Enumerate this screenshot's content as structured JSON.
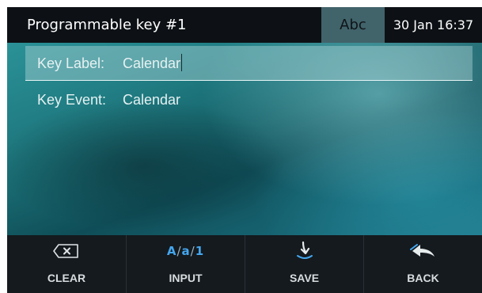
{
  "header": {
    "title": "Programmable key #1",
    "input_mode": "Abc",
    "datetime": "30 Jan 16:37"
  },
  "fields": [
    {
      "label": "Key Label:",
      "value": "Calendar",
      "selected": true
    },
    {
      "label": "Key Event:",
      "value": "Calendar",
      "selected": false
    }
  ],
  "softkeys": [
    {
      "label": "CLEAR",
      "icon": "backspace-icon"
    },
    {
      "label": "INPUT",
      "icon": "input-mode-icon",
      "glyph_parts": [
        "A",
        "/",
        "a",
        "/",
        "1"
      ]
    },
    {
      "label": "SAVE",
      "icon": "save-arrow-icon"
    },
    {
      "label": "BACK",
      "icon": "back-arrow-icon"
    }
  ],
  "colors": {
    "header_bg": "#0d1115",
    "mode_bg": "#41636a",
    "accent_blue": "#44a6ee",
    "softkey_bg": "#141a1e"
  }
}
